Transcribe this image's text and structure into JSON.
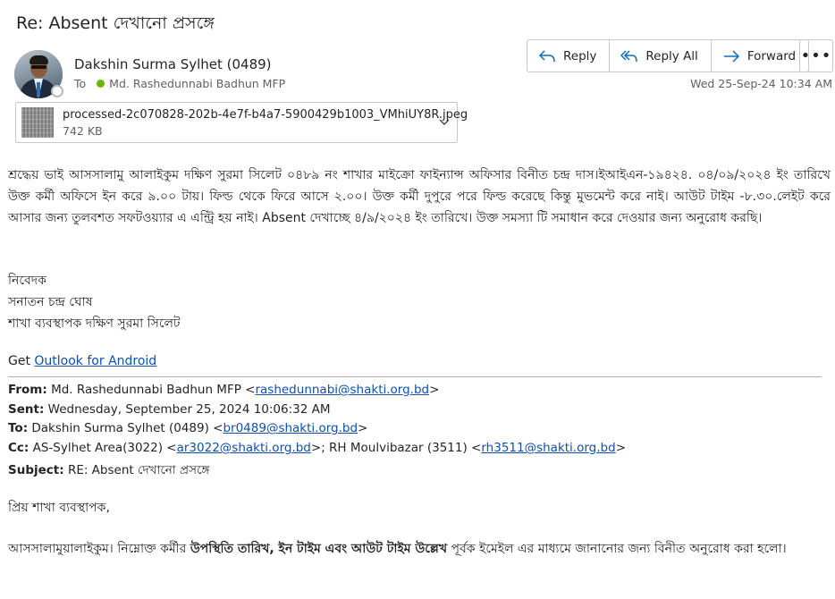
{
  "email": {
    "subject": "Re: Absent  দেখানো প্রসঙ্গে",
    "sender_name": "Dakshin Surma Sylhet (0489)",
    "to_label": "To",
    "recipient": "Md. Rashedunnabi Badhun MFP",
    "date": "Wed 25-Sep-24 10:34 AM"
  },
  "actions": {
    "reply": "Reply",
    "reply_all": "Reply All",
    "forward": "Forward",
    "more": "•••"
  },
  "attachment": {
    "filename": "processed-2c070828-202b-4e7f-b4a7-5900429b1003_VMhiUY8R.jpeg",
    "size": "742 KB"
  },
  "body": {
    "paragraph": "শ্রদ্ধেয় ভাই আসসালামু আলাইকুম দক্ষিণ সুরমা সিলেট ০৪৮৯ নং শাখার মাইক্রো ফাইন্যান্স অফিসার বিনীত চন্দ্র দাস।ইআইএন-১৯৪২৪. ০৪/০৯/২০২৪ ইং তারিখে উক্ত কর্মী অফিসে ইন করে ৯.০০ টায়। ফিল্ড থেকে ফিরে আসে ২.০০। উক্ত কর্মী দুপুরে পরে ফিল্ড করেছে কিন্তু মুভমেন্ট করে নাই। আউট টাইম -৮.৩০.লেইট করে আসার জন্য তুলবশত সফটওয়্যার এ এন্ট্রি হয় নাই। Absent দেখাচ্ছে ৪/৯/২০২৪ ইং তারিখে। উক্ত সমস্যা টি সমাধান করে দেওয়ার জন্য অনুরোধ করছি।",
    "sig_line1": "নিবেদক",
    "sig_line2": "সনাতন চন্দ্র ঘোষ",
    "sig_line3": "শাখা ব্যবস্থাপক দক্ষিণ সুরমা সিলেট",
    "get_text": "Get ",
    "get_link": "Outlook for Android"
  },
  "quoted": {
    "from_label": "From:",
    "from_name": "Md. Rashedunnabi Badhun MFP <",
    "from_email": "rashedunnabi@shakti.org.bd",
    "from_close": ">",
    "sent_label": "Sent:",
    "sent_value": "Wednesday, September 25, 2024 10:06:32 AM",
    "to_label": "To:",
    "to_name": "Dakshin Surma Sylhet (0489) <",
    "to_email": "br0489@shakti.org.bd",
    "to_close": ">",
    "cc_label": "Cc:",
    "cc_name1": "AS-Sylhet Area(3022) <",
    "cc_email1": "ar3022@shakti.org.bd",
    "cc_mid": ">; RH Moulvibazar (3511) <",
    "cc_email2": "rh3511@shakti.org.bd",
    "cc_close": ">",
    "subject_label": "Subject:",
    "subject_value": "RE: Absent দেখানো  প্রসঙ্গে",
    "greeting": "প্রিয় শাখা ব্যবস্থাপক,",
    "para_start": "আসসালামুয়ালাইকুম। নিম্নোক্ত কর্মীর ",
    "para_bold": "উপস্থিতি তারিখ, ইন টাইম এবং আউট টাইম উল্লেখ",
    "para_end": " পূর্বক ইমেইল এর মাধ্যমে জানানোর জন্য বিনীত অনুরোধ করা হলো।"
  },
  "colors": {
    "link": "#0f4fae",
    "presence_available": "#6bb700",
    "accent_icon": "#0f6cbd"
  }
}
